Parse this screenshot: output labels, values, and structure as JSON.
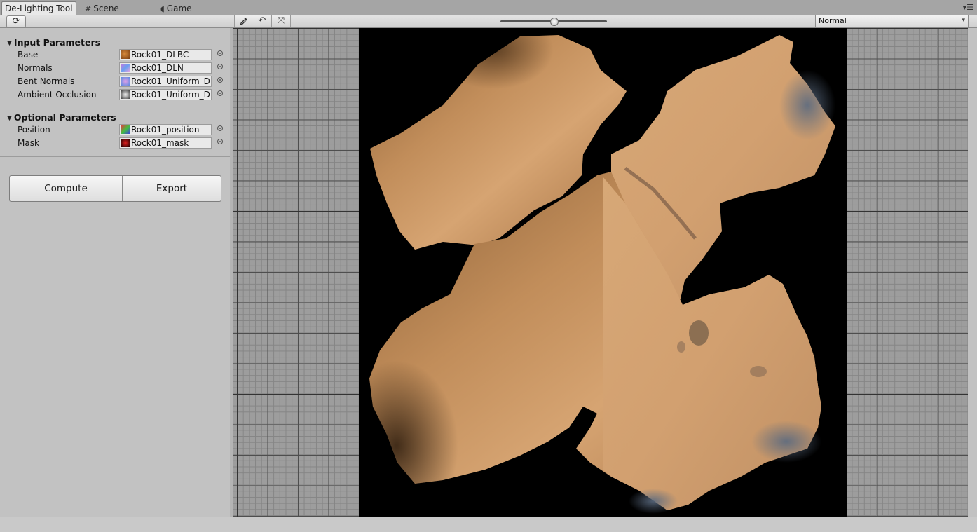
{
  "tabs": [
    {
      "label": "De-Lighting Tool",
      "icon": "",
      "active": true
    },
    {
      "label": "Scene",
      "icon": "grid-icon",
      "active": false
    },
    {
      "label": "Game",
      "icon": "pacman-icon",
      "active": false
    }
  ],
  "toolbar": {
    "view_mode": "Normal",
    "zoom_slider_value": 0.5
  },
  "input_parameters": {
    "header": "Input Parameters",
    "rows": [
      {
        "label": "Base",
        "value": "Rock01_DLBC",
        "thumb_color": "#b06a2a"
      },
      {
        "label": "Normals",
        "value": "Rock01_DLN",
        "thumb_color": "#8a7fd6"
      },
      {
        "label": "Bent Normals",
        "value": "Rock01_Uniform_D",
        "thumb_color": "#6c8fe0"
      },
      {
        "label": "Ambient Occlusion",
        "value": "Rock01_Uniform_D",
        "thumb_color": "#d8d8d8"
      }
    ]
  },
  "optional_parameters": {
    "header": "Optional Parameters",
    "rows": [
      {
        "label": "Position",
        "value": "Rock01_position",
        "thumb_color": "#5aa04a"
      },
      {
        "label": "Mask",
        "value": "Rock01_mask",
        "thumb_color": "#b01010"
      }
    ]
  },
  "actions": {
    "compute_label": "Compute",
    "export_label": "Export"
  }
}
